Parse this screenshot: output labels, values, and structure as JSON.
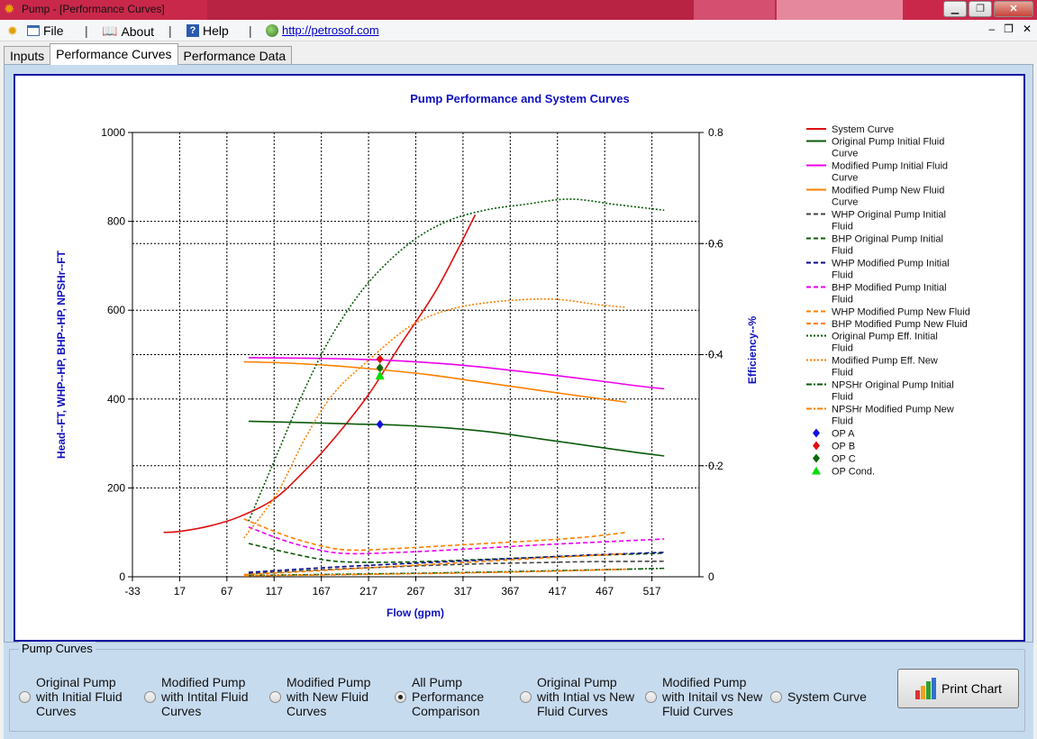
{
  "window": {
    "title": "Pump - [Performance Curves]"
  },
  "menu": {
    "file": "File",
    "about": "About",
    "help": "Help",
    "link": "http://petrosof.com",
    "separator": "|"
  },
  "tabs": [
    "Inputs",
    "Performance Curves",
    "Performance Data"
  ],
  "chart_data": {
    "type": "line",
    "title": "Pump Performance and System Curves",
    "xlabel": "Flow (gpm)",
    "ylabel": "Head--FT, WHP--HP, BHP--HP, NPSHr--FT",
    "y2label": "Efficiency--%",
    "xlim": [
      -33,
      567
    ],
    "ylim": [
      0,
      1000
    ],
    "y2lim": [
      0,
      0.8
    ],
    "x_ticks": [
      -33,
      17,
      67,
      117,
      167,
      217,
      267,
      317,
      367,
      417,
      467,
      517
    ],
    "y_ticks": [
      0,
      200,
      400,
      600,
      800,
      1000
    ],
    "y2_ticks": [
      0,
      0.2,
      0.4,
      0.6,
      0.8
    ],
    "grid": true,
    "legend_position": "right",
    "series": [
      {
        "name": "System Curve",
        "color": "#e01010",
        "dash": "solid",
        "axis": "left",
        "x": [
          0,
          17,
          50,
          80,
          117,
          150,
          180,
          217,
          250,
          290,
          330
        ],
        "y": [
          100,
          102,
          115,
          135,
          175,
          240,
          310,
          410,
          520,
          650,
          815
        ]
      },
      {
        "name": "Original Pump Initial Fluid Curve",
        "color": "#0a5a0a",
        "dash": "solid",
        "axis": "left",
        "x": [
          90,
          150,
          200,
          250,
          300,
          350,
          400,
          450,
          500,
          530
        ],
        "y": [
          350,
          347,
          344,
          341,
          335,
          325,
          310,
          295,
          280,
          272
        ]
      },
      {
        "name": "Modified Pump Initial Fluid Curve",
        "color": "#ee00ee",
        "dash": "solid",
        "axis": "left",
        "x": [
          90,
          150,
          200,
          250,
          300,
          350,
          400,
          450,
          500,
          530
        ],
        "y": [
          493,
          492,
          490,
          486,
          479,
          469,
          457,
          444,
          430,
          423
        ]
      },
      {
        "name": "Modified Pump New Fluid Curve",
        "color": "#ff8000",
        "dash": "solid",
        "axis": "left",
        "x": [
          85,
          130,
          180,
          230,
          280,
          330,
          380,
          430,
          490
        ],
        "y": [
          484,
          481,
          475,
          466,
          455,
          440,
          425,
          410,
          393
        ]
      },
      {
        "name": "WHP Original Pump Initial Fluid",
        "color": "#444444",
        "dash": "5,3",
        "axis": "left",
        "x": [
          90,
          150,
          200,
          250,
          300,
          350,
          400,
          450,
          530
        ],
        "y": [
          7,
          14,
          19,
          23,
          27,
          30,
          32,
          34,
          35
        ]
      },
      {
        "name": "BHP Original Pump Initial Fluid",
        "color": "#0a5a0a",
        "dash": "5,3",
        "axis": "left",
        "x": [
          90,
          130,
          170,
          200,
          250,
          300,
          350,
          400,
          450,
          530
        ],
        "y": [
          75,
          55,
          38,
          33,
          33,
          36,
          40,
          44,
          48,
          53
        ]
      },
      {
        "name": "WHP Modified Pump Initial Fluid",
        "color": "#0a0a8a",
        "dash": "5,3",
        "axis": "left",
        "x": [
          90,
          150,
          200,
          250,
          300,
          350,
          400,
          450,
          530
        ],
        "y": [
          10,
          18,
          24,
          29,
          34,
          39,
          44,
          49,
          55
        ]
      },
      {
        "name": "BHP Modified Pump Initial Fluid",
        "color": "#ee00ee",
        "dash": "5,3",
        "axis": "left",
        "x": [
          90,
          130,
          170,
          200,
          250,
          300,
          350,
          400,
          450,
          530
        ],
        "y": [
          112,
          80,
          58,
          52,
          55,
          60,
          66,
          72,
          77,
          85
        ]
      },
      {
        "name": "WHP Modified Pump New Fluid",
        "color": "#ff8000",
        "dash": "5,3",
        "axis": "left",
        "x": [
          85,
          150,
          200,
          250,
          300,
          350,
          400,
          490
        ],
        "y": [
          5,
          12,
          18,
          24,
          30,
          36,
          42,
          52
        ]
      },
      {
        "name": "BHP Modified Pump New Fluid",
        "color": "#ff8000",
        "dash": "5,3",
        "axis": "left",
        "x": [
          85,
          130,
          170,
          200,
          250,
          300,
          350,
          400,
          450,
          490
        ],
        "y": [
          130,
          92,
          68,
          60,
          64,
          70,
          76,
          82,
          90,
          100
        ]
      },
      {
        "name": "Original Pump Eff. Initial Fluid",
        "color": "#0a5a0a",
        "dash": "2,2",
        "axis": "right",
        "x": [
          90,
          120,
          150,
          180,
          217,
          260,
          300,
          340,
          380,
          430,
          480,
          530
        ],
        "y": [
          0.1,
          0.22,
          0.34,
          0.44,
          0.53,
          0.6,
          0.64,
          0.66,
          0.67,
          0.68,
          0.67,
          0.66
        ]
      },
      {
        "name": "Modified Pump Eff. New Fluid",
        "color": "#ff8000",
        "dash": "2,2",
        "axis": "right",
        "x": [
          85,
          120,
          150,
          180,
          217,
          260,
          300,
          350,
          410,
          460,
          490
        ],
        "y": [
          0.07,
          0.15,
          0.25,
          0.33,
          0.39,
          0.45,
          0.48,
          0.495,
          0.5,
          0.49,
          0.485
        ]
      },
      {
        "name": "NPSHr Original Pump Initial Fluid",
        "color": "#0a5a0a",
        "dash": "6,2,2,2",
        "axis": "left",
        "x": [
          90,
          200,
          300,
          400,
          530
        ],
        "y": [
          3,
          6,
          9,
          13,
          19
        ]
      },
      {
        "name": "NPSHr Modified Pump New Fluid",
        "color": "#ff8000",
        "dash": "6,2,2,2",
        "axis": "left",
        "x": [
          85,
          200,
          300,
          400,
          490
        ],
        "y": [
          2,
          5,
          8,
          12,
          17
        ]
      }
    ],
    "points": [
      {
        "name": "OP A",
        "color": "#1010e0",
        "shape": "diamond",
        "x": 229,
        "y": 343
      },
      {
        "name": "OP B",
        "color": "#e01010",
        "shape": "diamond",
        "x": 229,
        "y": 490
      },
      {
        "name": "OP C",
        "color": "#0a6a0a",
        "shape": "diamond",
        "x": 229,
        "y": 470
      },
      {
        "name": "OP Cond.",
        "color": "#00dd00",
        "shape": "triangle",
        "x": 229,
        "y": 452
      }
    ]
  },
  "options": {
    "group_title": "Pump Curves",
    "items": [
      {
        "label": "Original Pump\nwith Initial Fluid\nCurves",
        "selected": false
      },
      {
        "label": "Modified Pump\nwith Intital Fluid\nCurves",
        "selected": false
      },
      {
        "label": "Modified Pump\nwith New Fluid\nCurves",
        "selected": false
      },
      {
        "label": "All Pump\nPerformance\nComparison",
        "selected": true
      },
      {
        "label": "Original Pump\nwith Intial vs New\nFluid Curves",
        "selected": false
      },
      {
        "label": "Modified Pump\nwith Initail vs New\nFluid Curves",
        "selected": false
      },
      {
        "label": "System Curve",
        "selected": false
      }
    ],
    "print_label": "Print Chart"
  }
}
